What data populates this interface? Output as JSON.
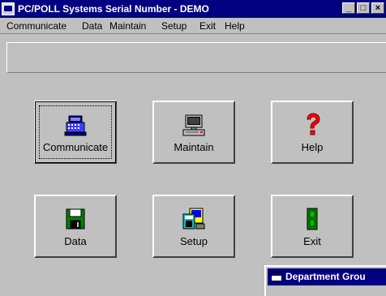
{
  "window": {
    "title": "PC/POLL Systems   Serial Number - DEMO",
    "buttons": {
      "minimize": "_",
      "maximize": "□",
      "close": "×"
    }
  },
  "menu": {
    "items": [
      {
        "label": "Communicate",
        "name": "menu-communicate"
      },
      {
        "label": "Data",
        "name": "menu-data"
      },
      {
        "label": "Maintain",
        "name": "menu-maintain"
      },
      {
        "label": "Setup",
        "name": "menu-setup"
      },
      {
        "label": "Exit",
        "name": "menu-exit"
      },
      {
        "label": "Help",
        "name": "menu-help"
      }
    ]
  },
  "main": {
    "buttons": [
      {
        "label": "Communicate",
        "icon": "cash-register-icon"
      },
      {
        "label": "Maintain",
        "icon": "computer-icon"
      },
      {
        "label": "Help",
        "icon": "question-mark-icon"
      },
      {
        "label": "Data",
        "icon": "floppy-disk-icon"
      },
      {
        "label": "Setup",
        "icon": "setup-icon"
      },
      {
        "label": "Exit",
        "icon": "exit-door-icon"
      }
    ]
  },
  "sub_window": {
    "title": "Department Grou"
  },
  "colors": {
    "titlebar": "#000080",
    "face": "#c0c0c0"
  }
}
